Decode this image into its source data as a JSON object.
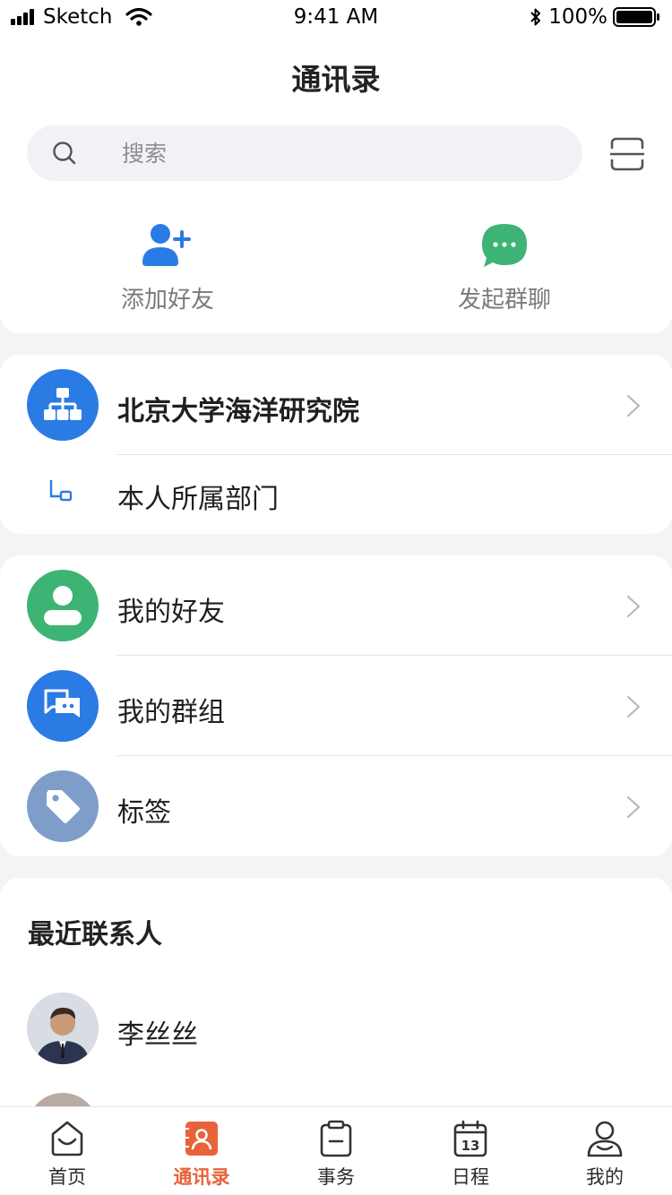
{
  "status_bar": {
    "carrier": "Sketch",
    "time": "9:41 AM",
    "battery": "100%"
  },
  "header": {
    "title": "通讯录"
  },
  "search": {
    "placeholder": "搜索"
  },
  "quick_actions": [
    {
      "label": "添加好友",
      "icon": "add-friend-icon",
      "color": "#2b7be4"
    },
    {
      "label": "发起群聊",
      "icon": "group-chat-icon",
      "color": "#3db474"
    }
  ],
  "organization": {
    "name": "北京大学海洋研究院",
    "department": "本人所属部门",
    "icon": "org-chart-icon",
    "color": "#2b7be4"
  },
  "contacts_menu": [
    {
      "label": "我的好友",
      "icon": "friend-icon",
      "color": "#3db474"
    },
    {
      "label": "我的群组",
      "icon": "group-icon",
      "color": "#2b7be4"
    },
    {
      "label": "标签",
      "icon": "tag-icon",
      "color": "#7e9ec9"
    }
  ],
  "recent": {
    "title": "最近联系人",
    "contacts": [
      {
        "name": "李丝丝"
      }
    ]
  },
  "tab_bar": {
    "active": "通讯录",
    "accent": "#e8633a",
    "tabs": [
      {
        "label": "首页",
        "icon": "home-icon"
      },
      {
        "label": "通讯录",
        "icon": "contacts-icon"
      },
      {
        "label": "事务",
        "icon": "clipboard-icon"
      },
      {
        "label": "日程",
        "icon": "calendar-icon",
        "day": "13"
      },
      {
        "label": "我的",
        "icon": "profile-icon"
      }
    ]
  }
}
